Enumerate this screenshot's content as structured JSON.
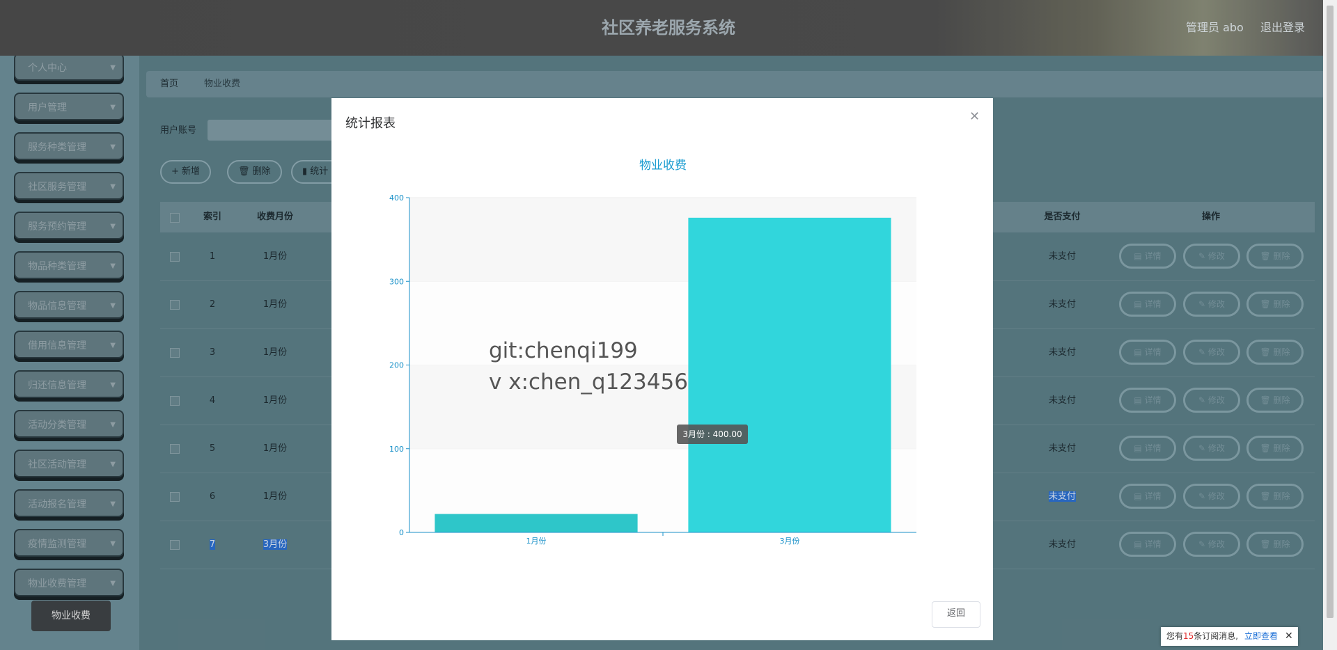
{
  "header": {
    "title": "社区养老服务系统",
    "admin": "管理员 abo",
    "logout": "退出登录"
  },
  "sidebar": {
    "items": [
      {
        "label": "个人中心"
      },
      {
        "label": "用户管理"
      },
      {
        "label": "服务种类管理"
      },
      {
        "label": "社区服务管理"
      },
      {
        "label": "服务预约管理"
      },
      {
        "label": "物品种类管理"
      },
      {
        "label": "物品信息管理"
      },
      {
        "label": "借用信息管理"
      },
      {
        "label": "归还信息管理"
      },
      {
        "label": "活动分类管理"
      },
      {
        "label": "社区活动管理"
      },
      {
        "label": "活动报名管理"
      },
      {
        "label": "疫情监测管理"
      },
      {
        "label": "物业收费管理"
      }
    ],
    "active_sub": "物业收费"
  },
  "breadcrumb": {
    "home": "首页",
    "current": "物业收费"
  },
  "filter": {
    "label": "用户账号",
    "value": ""
  },
  "toolbar": {
    "add": "+ 新增",
    "delete": "删除",
    "stats": "统计"
  },
  "table": {
    "headers": {
      "index": "索引",
      "month": "收费月份",
      "paid": "是否支付",
      "ops": "操作"
    },
    "rows": [
      {
        "index": "1",
        "month": "1月份",
        "paid": "未支付"
      },
      {
        "index": "2",
        "month": "1月份",
        "paid": "未支付"
      },
      {
        "index": "3",
        "month": "1月份",
        "paid": "未支付"
      },
      {
        "index": "4",
        "month": "1月份",
        "paid": "未支付"
      },
      {
        "index": "5",
        "month": "1月份",
        "paid": "未支付"
      },
      {
        "index": "6",
        "month": "1月份",
        "paid": "未支付"
      },
      {
        "index": "7",
        "month": "3月份",
        "paid": "未支付"
      }
    ],
    "op_labels": {
      "detail": "详情",
      "edit": "修改",
      "delete": "删除"
    }
  },
  "modal": {
    "title": "统计报表",
    "return": "返回",
    "watermark_line1": "git:chenqi199",
    "watermark_line2": "v x:chen_q123456",
    "tooltip": "3月份 : 400.00"
  },
  "notice": {
    "prefix": "您有",
    "count": "15",
    "suffix": "条订阅消息,",
    "link": "立即查看"
  },
  "chart_data": {
    "type": "bar",
    "title": "物业收费",
    "categories": [
      "1月份",
      "3月份"
    ],
    "values": [
      22,
      376
    ],
    "ylim": [
      0,
      400
    ],
    "yticks": [
      0,
      100,
      200,
      300,
      400
    ],
    "grid": true,
    "colors": {
      "bar": "#31d6dc",
      "bar_first": "#2ec6c9",
      "axis": "#1890c8",
      "title": "#1a9cd0"
    }
  }
}
